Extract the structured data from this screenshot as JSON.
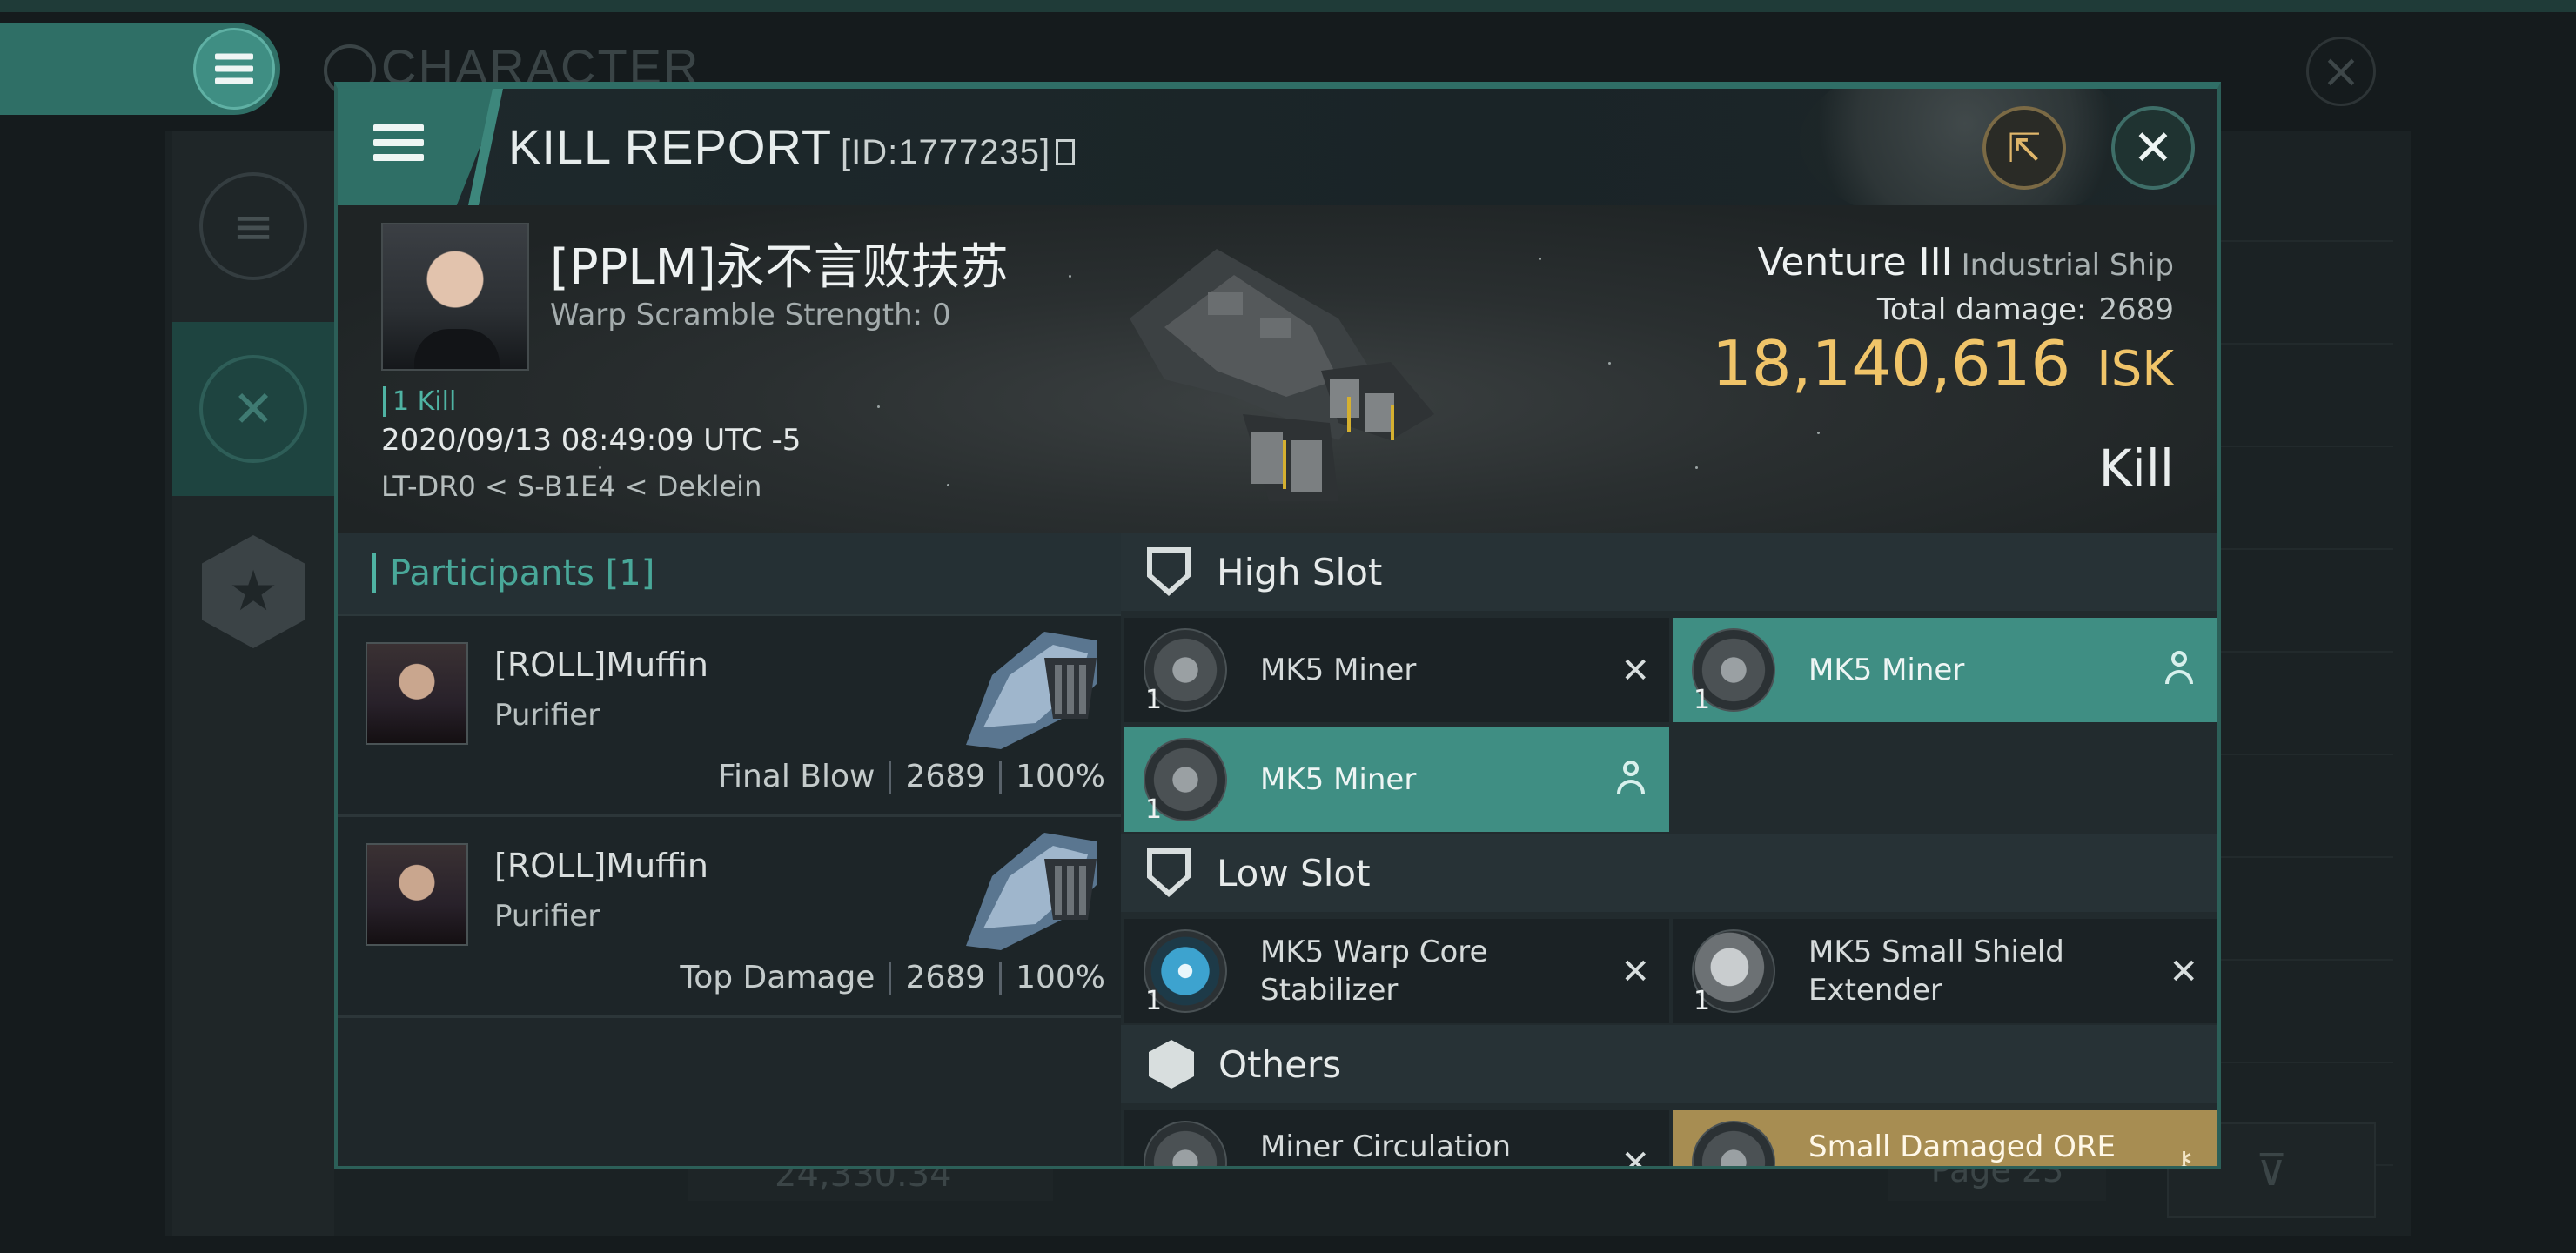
{
  "background": {
    "title": "CHARACTER",
    "bottom_value": "24,330.34",
    "page_label": "Page 23"
  },
  "modal": {
    "title": "KILL REPORT",
    "report_id": "[ID:1777235]",
    "share_icon": "share-icon",
    "close_icon": "close-icon"
  },
  "victim": {
    "name": "[PPLM]永不言败扶苏",
    "warp_scramble": "Warp Scramble Strength: 0",
    "kill_count": "1 Kill",
    "time": "2020/09/13 08:49:09 UTC -5",
    "location": "LT-DR0 < S-B1E4 < Deklein"
  },
  "ship": {
    "name": "Venture III",
    "class": "Industrial Ship",
    "total_damage_label": "Total damage:",
    "total_damage": "2689",
    "isk_value": "18,140,616",
    "isk_unit": "ISK",
    "result": "Kill"
  },
  "participants": {
    "header": "Participants [1]",
    "rows": [
      {
        "name": "[ROLL]Muffin",
        "ship": "Purifier",
        "role": "Final Blow",
        "damage": "2689",
        "percent": "100%"
      },
      {
        "name": "[ROLL]Muffin",
        "ship": "Purifier",
        "role": "Top Damage",
        "damage": "2689",
        "percent": "100%"
      }
    ]
  },
  "slots": {
    "high": {
      "label": "High Slot",
      "items": [
        {
          "name": "MK5 Miner",
          "qty": "1",
          "state": "destroyed"
        },
        {
          "name": "MK5 Miner",
          "qty": "1",
          "state": "dropped"
        },
        {
          "name": "MK5 Miner",
          "qty": "1",
          "state": "dropped"
        }
      ]
    },
    "low": {
      "label": "Low Slot",
      "items": [
        {
          "name": "MK5 Warp Core Stabilizer",
          "qty": "1",
          "state": "destroyed"
        },
        {
          "name": "MK5 Small Shield Extender",
          "qty": "1",
          "state": "destroyed"
        }
      ]
    },
    "others": {
      "label": "Others",
      "items": [
        {
          "name": "Miner Circulation",
          "state": "destroyed"
        },
        {
          "name": "Small Damaged ORE",
          "state": "special"
        }
      ]
    }
  },
  "colors": {
    "accent_teal": "#3f8e83",
    "isk_gold": "#f0c469",
    "rare_gold": "#a78d52"
  }
}
